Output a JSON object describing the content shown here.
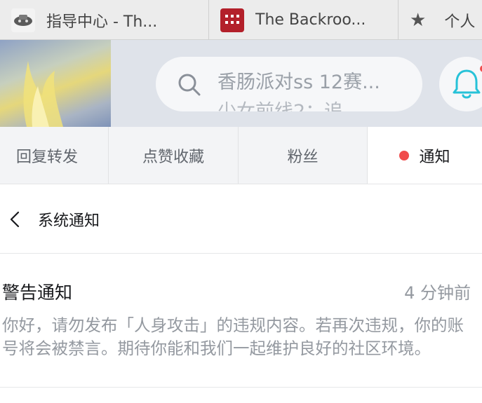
{
  "browser_tabs": [
    {
      "title": "指导中心 - Th...",
      "icon": "guide-center-favicon"
    },
    {
      "title": "The Backroo...",
      "icon": "backrooms-favicon"
    },
    {
      "title": "个人",
      "icon": "star-icon"
    }
  ],
  "header": {
    "search_placeholder": "香肠派对ss 12赛...",
    "search_placeholder_next": "少女前线2：追",
    "bell_icon": "bell-icon",
    "accent": "#27c2d8"
  },
  "message_tabs": [
    {
      "label": "回复转发"
    },
    {
      "label": "点赞收藏"
    },
    {
      "label": "粉丝"
    },
    {
      "label": "通知",
      "active": true
    }
  ],
  "page": {
    "title": "系统通知"
  },
  "notices": [
    {
      "title": "警告通知",
      "time": "4 分钟前",
      "body": "你好，请勿发布「人身攻击」的违规内容。若再次违规，你的账号将会被禁言。期待你能和我们一起维护良好的社区环境。"
    }
  ],
  "colors": {
    "unread_dot": "#f04c4c",
    "muted_text": "#9499a0"
  }
}
